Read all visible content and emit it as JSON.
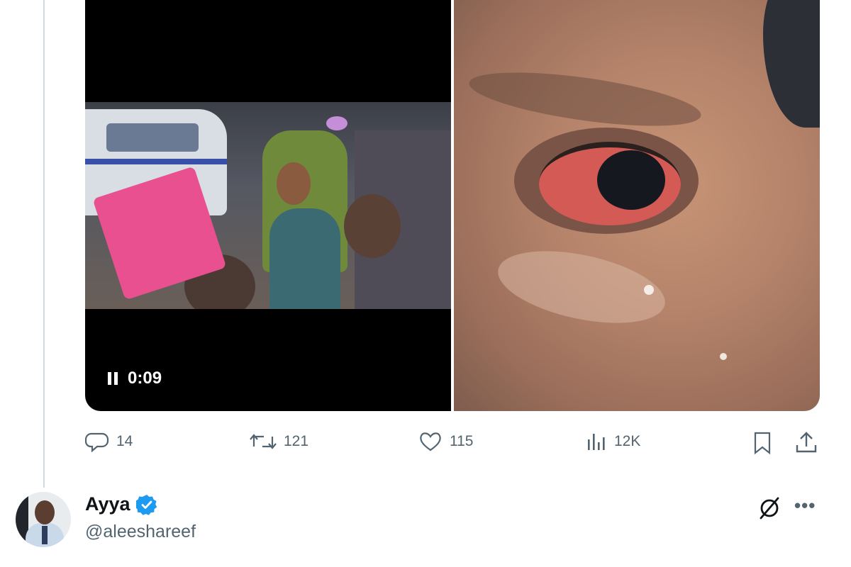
{
  "media": {
    "video": {
      "elapsed": "0:09",
      "state": "playing"
    },
    "photo": {
      "subject": "eye-closeup"
    }
  },
  "actions": {
    "replies": "14",
    "retweets": "121",
    "likes": "115",
    "views": "12K"
  },
  "author": {
    "name": "Ayya",
    "handle": "@aleeshareef",
    "verified": true,
    "verified_color": "#1d9bf0"
  },
  "colors": {
    "muted_text": "#536471",
    "thread_line": "#cfd9de"
  },
  "icons": [
    "reply-icon",
    "retweet-icon",
    "like-icon",
    "views-icon",
    "bookmark-icon",
    "share-icon",
    "verified-badge-icon",
    "grok-icon",
    "more-icon",
    "pause-icon"
  ]
}
